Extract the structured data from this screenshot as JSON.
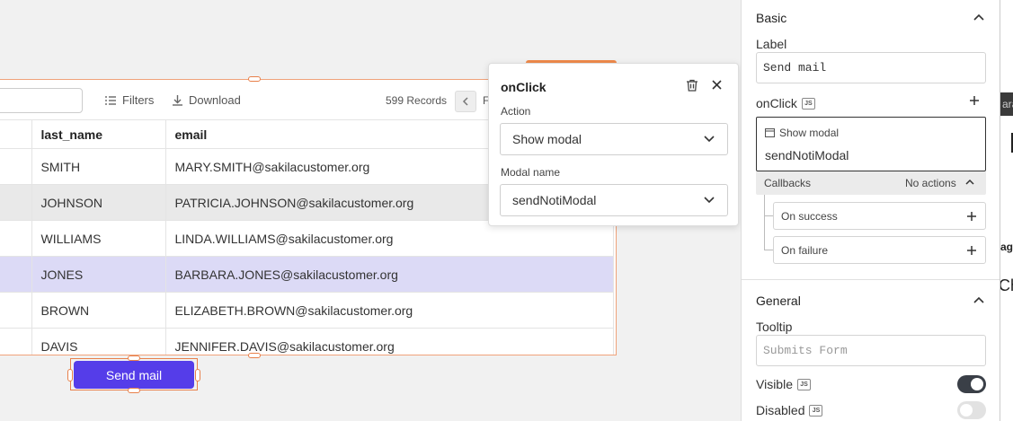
{
  "table": {
    "toolbar": {
      "filters_label": "Filters",
      "download_label": "Download",
      "records_text": "599 Records",
      "page_letter": "F"
    },
    "headers": [
      "last_name",
      "email"
    ],
    "rows": [
      {
        "last_name": "SMITH",
        "email": "MARY.SMITH@sakilacustomer.org"
      },
      {
        "last_name": "JOHNSON",
        "email": "PATRICIA.JOHNSON@sakilacustomer.org"
      },
      {
        "last_name": "WILLIAMS",
        "email": "LINDA.WILLIAMS@sakilacustomer.org"
      },
      {
        "last_name": "JONES",
        "email": "BARBARA.JONES@sakilacustomer.org"
      },
      {
        "last_name": "BROWN",
        "email": "ELIZABETH.BROWN@sakilacustomer.org"
      },
      {
        "last_name": "DAVIS",
        "email": "JENNIFER.DAVIS@sakilacustomer.org"
      }
    ]
  },
  "send_mail_button": {
    "label": "Send mail"
  },
  "popover": {
    "title": "onClick",
    "action_label": "Action",
    "action_value": "Show modal",
    "modal_name_label": "Modal name",
    "modal_name_value": "sendNotiModal"
  },
  "right_panel": {
    "basic": {
      "title": "Basic",
      "label_field_label": "Label",
      "label_value": "Send mail",
      "onclick_label": "onClick",
      "js_badge": "JS",
      "action_type": "Show modal",
      "action_target": "sendNotiModal",
      "callbacks_label": "Callbacks",
      "callbacks_status": "No actions",
      "on_success": "On success",
      "on_failure": "On failure"
    },
    "general": {
      "title": "General",
      "tooltip_label": "Tooltip",
      "tooltip_placeholder": "Submits Form",
      "visible_label": "Visible",
      "visible_on": true,
      "disabled_label": "Disabled",
      "disabled_on": false
    }
  },
  "sliver": {
    "dark_text": "ara",
    "age_text": "age",
    "ch_text": "Ch"
  },
  "colors": {
    "accent": "#553de9",
    "selection": "#e8804a",
    "selected_row": "#dcdaf6"
  }
}
